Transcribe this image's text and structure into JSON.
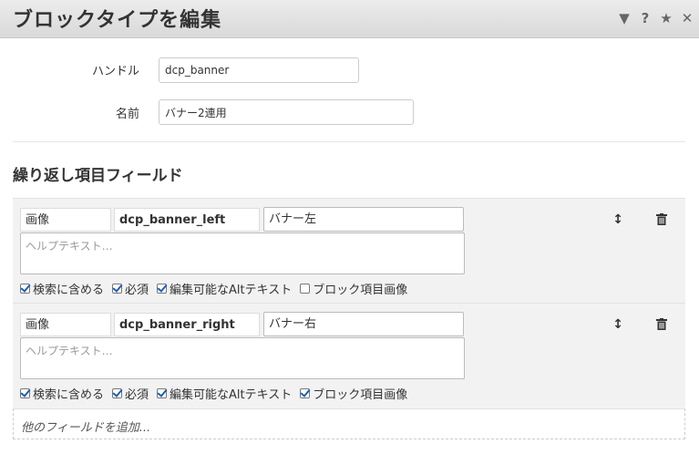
{
  "dialog": {
    "title": "ブロックタイプを編集",
    "controls": [
      "▼",
      "?",
      "★",
      "✕"
    ]
  },
  "form": {
    "handle_label": "ハンドル",
    "handle_value": "dcp_banner",
    "name_label": "名前",
    "name_value": "バナー2連用"
  },
  "repeat": {
    "section_title": "繰り返し項目フィールド",
    "fields": [
      {
        "type": "画像",
        "handle": "dcp_banner_left",
        "label": "バナー左",
        "help_placeholder": "ヘルプテキスト…",
        "checks": [
          {
            "label": "検索に含める",
            "checked": true
          },
          {
            "label": "必須",
            "checked": true
          },
          {
            "label": "編集可能なAltテキスト",
            "checked": true
          },
          {
            "label": "ブロック項目画像",
            "checked": false
          }
        ]
      },
      {
        "type": "画像",
        "handle": "dcp_banner_right",
        "label": "バナー右",
        "help_placeholder": "ヘルプテキスト…",
        "checks": [
          {
            "label": "検索に含める",
            "checked": true
          },
          {
            "label": "必須",
            "checked": true
          },
          {
            "label": "編集可能なAltテキスト",
            "checked": true
          },
          {
            "label": "ブロック項目画像",
            "checked": true
          }
        ]
      }
    ],
    "add_field": "他のフィールドを追加..."
  },
  "icons": {
    "sort": "↕",
    "trash": "trash-icon"
  }
}
